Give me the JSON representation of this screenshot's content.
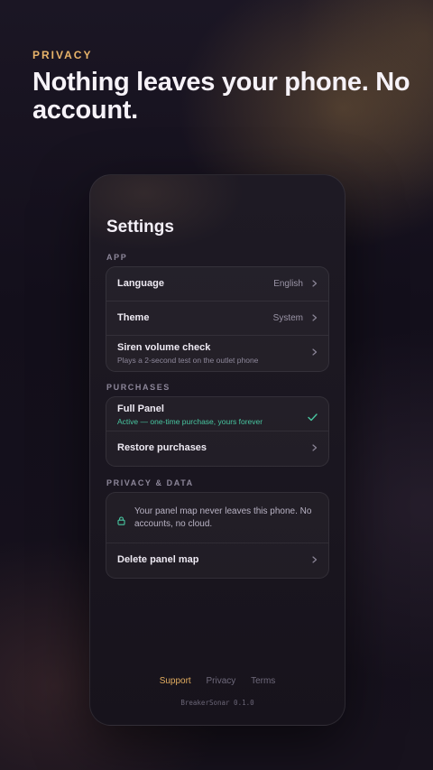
{
  "promo": {
    "eyebrow": "PRIVACY",
    "headline": "Nothing leaves your phone. No account."
  },
  "screen": {
    "title": "Settings",
    "sections": {
      "app": {
        "label": "APP",
        "rows": [
          {
            "title": "Language",
            "value": "English"
          },
          {
            "title": "Theme",
            "value": "System"
          },
          {
            "title": "Siren volume check",
            "subtitle": "Plays a 2-second test on the outlet phone"
          }
        ]
      },
      "purchases": {
        "label": "PURCHASES",
        "rows": [
          {
            "title": "Full Panel",
            "subtitle": "Active — one-time purchase, yours forever",
            "status": "check-icon"
          },
          {
            "title": "Restore purchases"
          }
        ]
      },
      "privacy": {
        "label": "PRIVACY & DATA",
        "note": "Your panel map never leaves this phone. No accounts, no cloud.",
        "note_icon": "lock-icon",
        "rows": [
          {
            "title": "Delete panel map"
          }
        ]
      }
    },
    "footer": {
      "links": [
        "Support",
        "Privacy",
        "Terms"
      ],
      "version": "BreakerSonar 0.1.0"
    }
  },
  "colors": {
    "accent": "#e9b46a",
    "success": "#48c6a0",
    "background": "#14101c"
  }
}
